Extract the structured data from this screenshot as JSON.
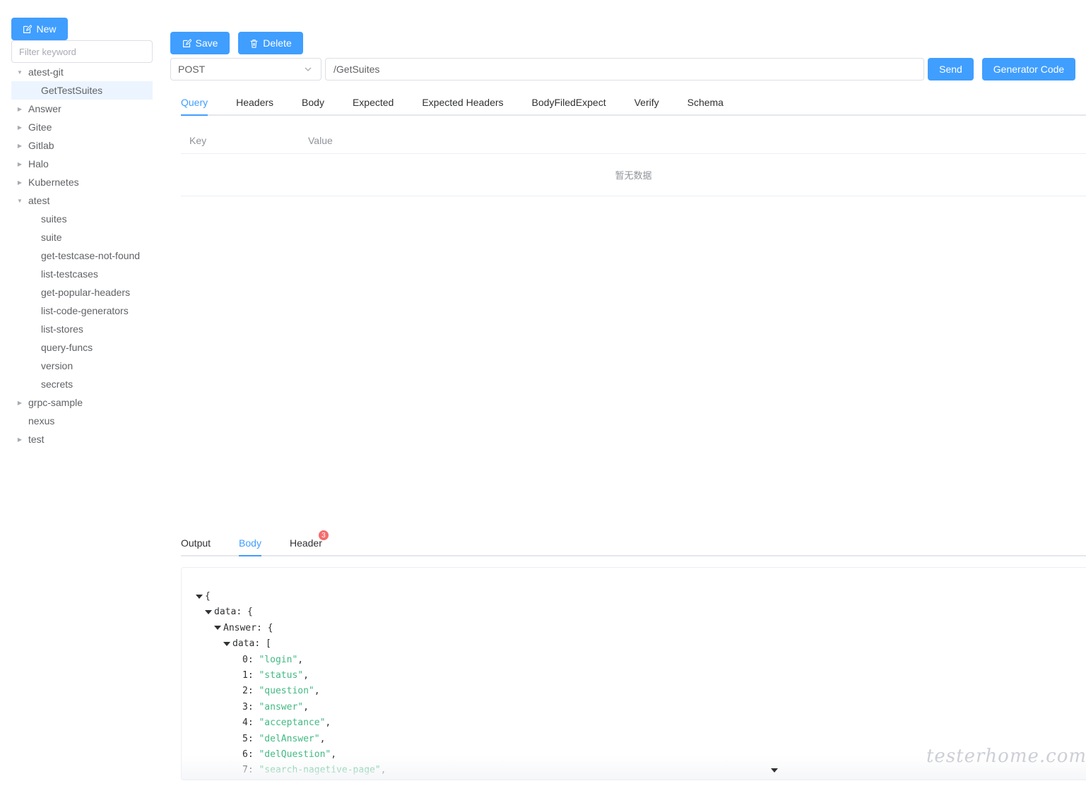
{
  "sidebar": {
    "new_label": "New",
    "filter_placeholder": "Filter keyword",
    "tree": [
      {
        "label": "atest-git",
        "expanded": true,
        "children": [
          "GetTestSuites"
        ]
      },
      {
        "label": "Answer",
        "expanded": false
      },
      {
        "label": "Gitee",
        "expanded": false
      },
      {
        "label": "Gitlab",
        "expanded": false
      },
      {
        "label": "Halo",
        "expanded": false
      },
      {
        "label": "Kubernetes",
        "expanded": false
      },
      {
        "label": "atest",
        "expanded": true,
        "children": [
          "suites",
          "suite",
          "get-testcase-not-found",
          "list-testcases",
          "get-popular-headers",
          "list-code-generators",
          "list-stores",
          "query-funcs",
          "version",
          "secrets"
        ]
      },
      {
        "label": "grpc-sample",
        "expanded": false
      },
      {
        "label": "nexus",
        "expanded": null
      },
      {
        "label": "test",
        "expanded": false
      }
    ],
    "selected": "GetTestSuites"
  },
  "toolbar": {
    "save_label": "Save",
    "delete_label": "Delete",
    "method": "POST",
    "url": "/GetSuites",
    "send_label": "Send",
    "generator_label": "Generator Code"
  },
  "request_tabs": [
    "Query",
    "Headers",
    "Body",
    "Expected",
    "Expected Headers",
    "BodyFiledExpect",
    "Verify",
    "Schema"
  ],
  "request_active_tab": "Query",
  "query_table": {
    "headers": [
      "Key",
      "Value"
    ],
    "empty_text": "暂无数据"
  },
  "response_tabs": [
    "Output",
    "Body",
    "Header"
  ],
  "response_active_tab": "Body",
  "header_badge": "3",
  "json_lines": [
    {
      "indent": 0,
      "caret": true,
      "key": "",
      "open": "{"
    },
    {
      "indent": 1,
      "caret": true,
      "key": "data",
      "open": "{"
    },
    {
      "indent": 2,
      "caret": true,
      "key": "Answer",
      "open": "{"
    },
    {
      "indent": 3,
      "caret": true,
      "key": "data",
      "open": "["
    },
    {
      "indent": 4,
      "caret": false,
      "key": "0",
      "value": "\"login\"",
      "comma": true
    },
    {
      "indent": 4,
      "caret": false,
      "key": "1",
      "value": "\"status\"",
      "comma": true
    },
    {
      "indent": 4,
      "caret": false,
      "key": "2",
      "value": "\"question\"",
      "comma": true
    },
    {
      "indent": 4,
      "caret": false,
      "key": "3",
      "value": "\"answer\"",
      "comma": true
    },
    {
      "indent": 4,
      "caret": false,
      "key": "4",
      "value": "\"acceptance\"",
      "comma": true
    },
    {
      "indent": 4,
      "caret": false,
      "key": "5",
      "value": "\"delAnswer\"",
      "comma": true
    },
    {
      "indent": 4,
      "caret": false,
      "key": "6",
      "value": "\"delQuestion\"",
      "comma": true
    },
    {
      "indent": 4,
      "caret": false,
      "key": "7",
      "value": "\"search-nagetive-page\"",
      "comma": true
    }
  ],
  "watermark": "testerhome.com"
}
